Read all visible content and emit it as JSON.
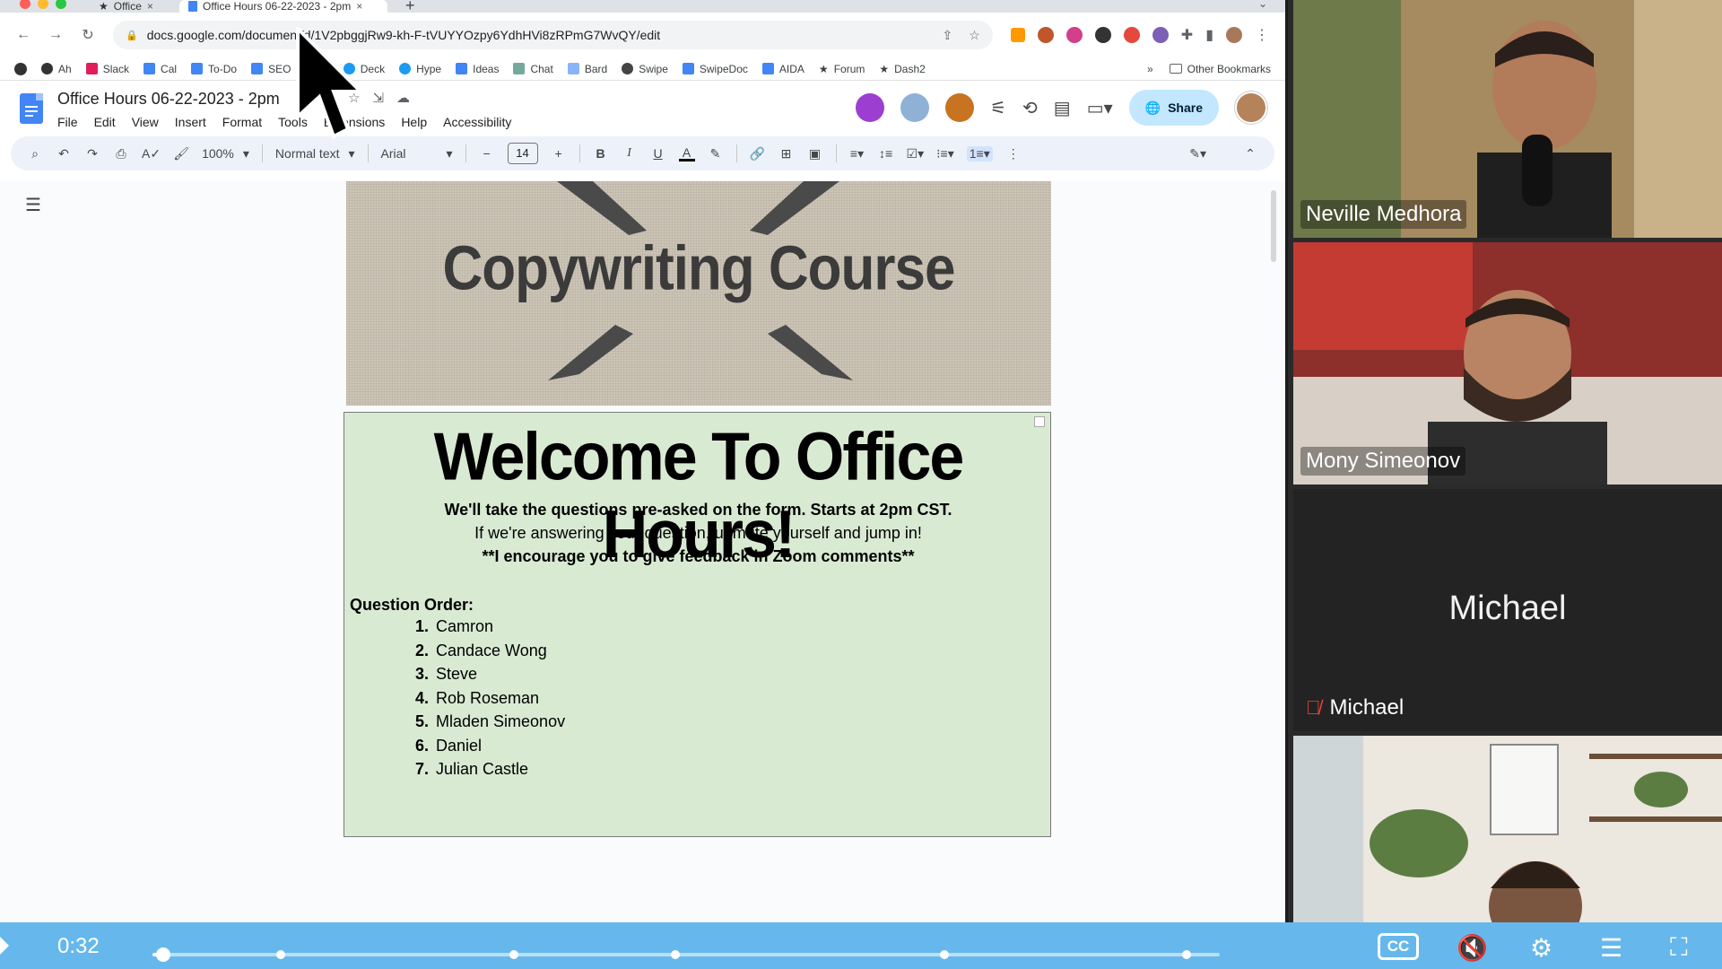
{
  "browser": {
    "tabs": [
      {
        "label": "Office"
      },
      {
        "label": "Office Hours 06-22-2023 - 2pm"
      }
    ],
    "url": "docs.google.com/document/d/1V2pbggjRw9-kh-F-tVUYYOzpy6YdhHVi8zRPmG7WvQY/edit",
    "bookmarks": [
      "Ah",
      "Slack",
      "Cal",
      "To-Do",
      "SEO",
      "T",
      "Deck",
      "Hype",
      "Ideas",
      "Chat",
      "Bard",
      "Swipe",
      "SwipeDoc",
      "AIDA",
      "Forum",
      "Dash2"
    ],
    "bookmarks_overflow": "»",
    "other_bookmarks": "Other Bookmarks"
  },
  "docs": {
    "title": "Office Hours 06-22-2023 - 2pm",
    "menu": [
      "File",
      "Edit",
      "View",
      "Insert",
      "Format",
      "Tools",
      "Extensions",
      "Help",
      "Accessibility"
    ],
    "share_label": "Share",
    "toolbar": {
      "zoom": "100%",
      "style": "Normal text",
      "font": "Arial",
      "font_size": "14"
    }
  },
  "document": {
    "banner_title": "Copywriting Course",
    "welcome_heading": "Welcome To Office Hours!",
    "line1": "We'll take the questions pre-asked on the form. Starts at 2pm CST.",
    "line2": "If we're answering your question, unmute yourself and jump in!",
    "line3": "**I encourage you to give feedback in Zoom comments**",
    "question_order_label": "Question Order:",
    "question_order": [
      {
        "num": "1.",
        "name": "Camron"
      },
      {
        "num": "2.",
        "name": "Candace Wong"
      },
      {
        "num": "3.",
        "name": "Steve"
      },
      {
        "num": "4.",
        "name": "Rob Roseman"
      },
      {
        "num": "5.",
        "name": "Mladen Simeonov"
      },
      {
        "num": "6.",
        "name": "Daniel"
      },
      {
        "num": "7.",
        "name": "Julian Castle"
      }
    ]
  },
  "participants": [
    {
      "name": "Neville Medhora"
    },
    {
      "name": "Mony Simeonov"
    },
    {
      "name": "Michael",
      "center_name": "Michael",
      "muted": true
    },
    {
      "name": ""
    }
  ],
  "player": {
    "time": "0:32",
    "progress_fraction": 0.01,
    "cc_label": "CC"
  },
  "colors": {
    "accent": "#66b8ec",
    "welcome_bg": "#d9ead3",
    "share_bg": "#c2e7ff",
    "docs_blue": "#4285f4"
  }
}
